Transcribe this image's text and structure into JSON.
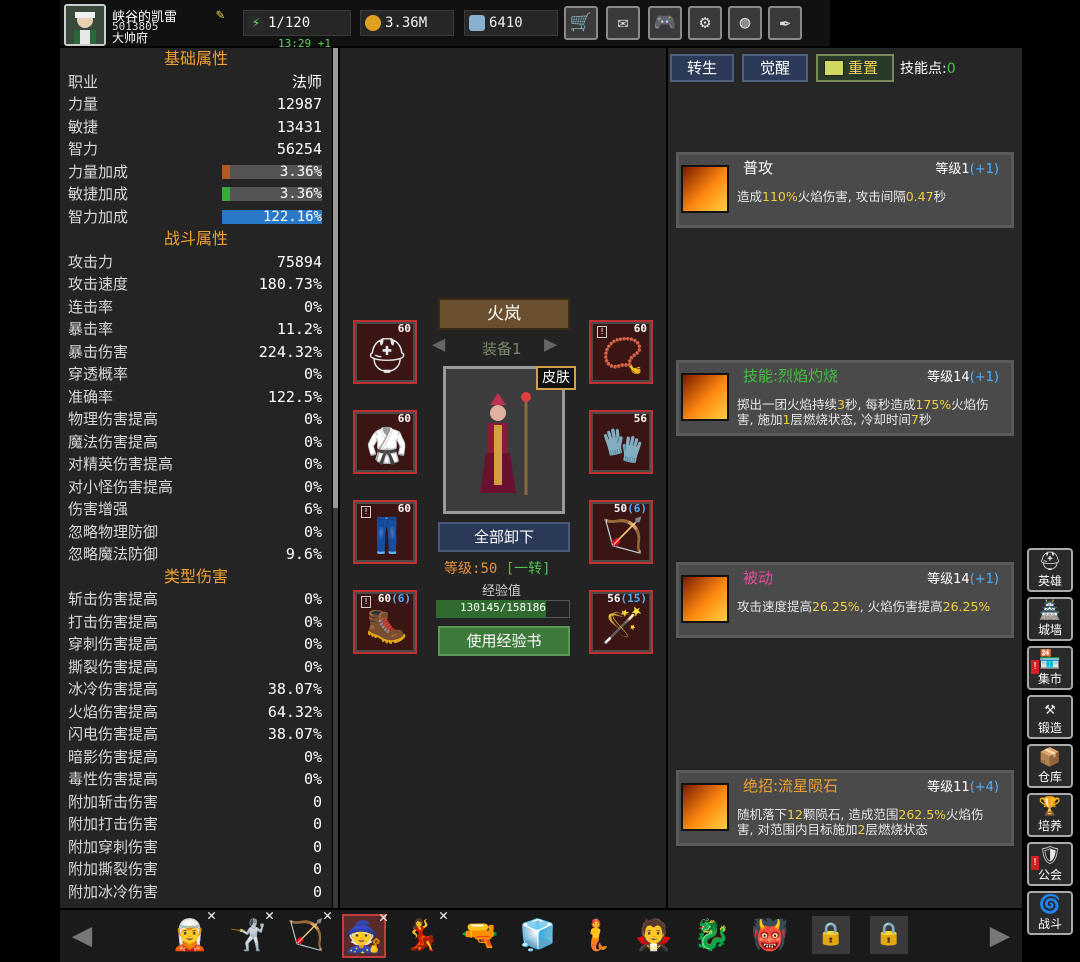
{
  "player": {
    "name": "峡谷的凯雷",
    "id": "5013805",
    "title": "大帅府",
    "timer": "13:29 +1"
  },
  "resources": {
    "energy": "1/120",
    "gold": "3.36M",
    "gems": "6410"
  },
  "toolbar": [
    {
      "icon": "shop-cart-icon",
      "glyph": "🛒"
    },
    {
      "icon": "mail-icon",
      "glyph": "✉"
    },
    {
      "icon": "gamepad-icon",
      "glyph": "🎮"
    },
    {
      "icon": "gear-icon",
      "glyph": "⚙"
    },
    {
      "icon": "color-wheel-icon",
      "glyph": "◍"
    },
    {
      "icon": "quill-icon",
      "glyph": "✒"
    }
  ],
  "stats": {
    "basic_header": "基础属性",
    "basic": [
      {
        "k": "职业",
        "v": "法师"
      },
      {
        "k": "力量",
        "v": "12987"
      },
      {
        "k": "敏捷",
        "v": "13431"
      },
      {
        "k": "智力",
        "v": "56254"
      }
    ],
    "bonus": [
      {
        "k": "力量加成",
        "v": "3.36%",
        "fill": 0.08,
        "color": "#b05a28"
      },
      {
        "k": "敏捷加成",
        "v": "3.36%",
        "fill": 0.08,
        "color": "#38a838"
      },
      {
        "k": "智力加成",
        "v": "122.16%",
        "fill": 1.0,
        "color": "#2a78c8"
      }
    ],
    "combat_header": "战斗属性",
    "combat": [
      {
        "k": "攻击力",
        "v": "75894"
      },
      {
        "k": "攻击速度",
        "v": "180.73%"
      },
      {
        "k": "连击率",
        "v": "0%"
      },
      {
        "k": "暴击率",
        "v": "11.2%"
      },
      {
        "k": "暴击伤害",
        "v": "224.32%"
      },
      {
        "k": "穿透概率",
        "v": "0%"
      },
      {
        "k": "准确率",
        "v": "122.5%"
      },
      {
        "k": "物理伤害提高",
        "v": "0%"
      },
      {
        "k": "魔法伤害提高",
        "v": "0%"
      },
      {
        "k": "对精英伤害提高",
        "v": "0%"
      },
      {
        "k": "对小怪伤害提高",
        "v": "0%"
      },
      {
        "k": "伤害增强",
        "v": "6%"
      },
      {
        "k": "忽略物理防御",
        "v": "0%"
      },
      {
        "k": "忽略魔法防御",
        "v": "9.6%"
      }
    ],
    "type_header": "类型伤害",
    "type": [
      {
        "k": "斩击伤害提高",
        "v": "0%"
      },
      {
        "k": "打击伤害提高",
        "v": "0%"
      },
      {
        "k": "穿刺伤害提高",
        "v": "0%"
      },
      {
        "k": "撕裂伤害提高",
        "v": "0%"
      },
      {
        "k": "冰冷伤害提高",
        "v": "38.07%"
      },
      {
        "k": "火焰伤害提高",
        "v": "64.32%"
      },
      {
        "k": "闪电伤害提高",
        "v": "38.07%"
      },
      {
        "k": "暗影伤害提高",
        "v": "0%"
      },
      {
        "k": "毒性伤害提高",
        "v": "0%"
      },
      {
        "k": "附加斩击伤害",
        "v": "0"
      },
      {
        "k": "附加打击伤害",
        "v": "0"
      },
      {
        "k": "附加穿刺伤害",
        "v": "0"
      },
      {
        "k": "附加撕裂伤害",
        "v": "0"
      },
      {
        "k": "附加冰冷伤害",
        "v": "0"
      }
    ]
  },
  "equipment": {
    "hero_name": "火岚",
    "set_name": "装备1",
    "skin_label": "皮肤",
    "unequip_label": "全部卸下",
    "level_label": "等级:",
    "level": "50",
    "rebirth": "[一转]",
    "exp_label": "经验值",
    "exp": "130145/158186",
    "exp_fraction": 0.823,
    "use_book_label": "使用经验书",
    "slots": [
      {
        "name": "helmet-slot",
        "level": "60",
        "extra": "",
        "glyph": "⛑",
        "flag": false
      },
      {
        "name": "necklace-slot",
        "level": "60",
        "extra": "",
        "glyph": "📿",
        "flag": true
      },
      {
        "name": "armor-slot",
        "level": "60",
        "extra": "",
        "glyph": "🥋",
        "flag": false
      },
      {
        "name": "gloves-slot",
        "level": "56",
        "extra": "",
        "glyph": "🧤",
        "flag": false
      },
      {
        "name": "pants-slot",
        "level": "60",
        "extra": "",
        "glyph": "👖",
        "flag": true
      },
      {
        "name": "offhand-slot",
        "level": "50",
        "extra": "(6)",
        "glyph": "🏹",
        "flag": false
      },
      {
        "name": "boots-slot",
        "level": "60",
        "extra": "(6)",
        "glyph": "🥾",
        "flag": true
      },
      {
        "name": "staff-slot",
        "level": "56",
        "extra": "(15)",
        "glyph": "🪄",
        "flag": false
      }
    ]
  },
  "skills_panel": {
    "rebirth_tab": "转生",
    "awaken_tab": "觉醒",
    "reset_label": "重置",
    "points_label": "技能点:",
    "points": "0",
    "cards": [
      {
        "name": "普攻",
        "name_color": "#ffffff",
        "level": "等级1",
        "bonus": "(+1)",
        "desc_parts": [
          "造成",
          "110%",
          "火焰伤害, 攻击间隔",
          "0.47",
          "秒"
        ]
      },
      {
        "name": "技能:烈焰灼烧",
        "name_color": "#40c040",
        "level": "等级14",
        "bonus": "(+1)",
        "desc_parts": [
          "掷出一团火焰持续",
          "3",
          "秒, 每秒造成",
          "175%",
          "火焰伤害, 施加",
          "1",
          "层燃烧状态, 冷却时间",
          "7",
          "秒"
        ]
      },
      {
        "name": "被动",
        "name_color": "#e84a9a",
        "level": "等级14",
        "bonus": "(+1)",
        "desc_parts": [
          "攻击速度提高",
          "26.25%",
          ", 火焰伤害提高",
          "26.25%",
          ""
        ]
      },
      {
        "name": "绝招:流星陨石",
        "name_color": "#f0a030",
        "level": "等级11",
        "bonus": "(+4)",
        "desc_parts": [
          "随机落下",
          "12",
          "颗陨石, 造成范围",
          "262.5%",
          "火焰伤害, 对范围内目标施加",
          "2",
          "层燃烧状态"
        ]
      }
    ]
  },
  "side_nav": [
    {
      "label": "英雄",
      "icon": "helmet-icon",
      "glyph": "⛑",
      "alert": false
    },
    {
      "label": "城墙",
      "icon": "wall-icon",
      "glyph": "🏯",
      "alert": false
    },
    {
      "label": "集市",
      "icon": "market-icon",
      "glyph": "🏪",
      "alert": true
    },
    {
      "label": "锻造",
      "icon": "anvil-icon",
      "glyph": "⚒",
      "alert": false
    },
    {
      "label": "仓库",
      "icon": "chest-icon",
      "glyph": "📦",
      "alert": false
    },
    {
      "label": "培养",
      "icon": "trophy-icon",
      "glyph": "🏆",
      "alert": false
    },
    {
      "label": "公会",
      "icon": "guild-icon",
      "glyph": "🛡",
      "alert": true
    },
    {
      "label": "战斗",
      "icon": "portal-icon",
      "glyph": "🌀",
      "alert": false
    }
  ],
  "heroes": [
    {
      "icon": "elf-hero-icon",
      "glyph": "🧝",
      "x": true,
      "selected": false
    },
    {
      "icon": "knight-hero-icon",
      "glyph": "🤺",
      "x": true,
      "selected": false
    },
    {
      "icon": "archer-hero-icon",
      "glyph": "🏹",
      "x": true,
      "selected": false
    },
    {
      "icon": "mage-hero-icon",
      "glyph": "🧙",
      "x": true,
      "selected": true
    },
    {
      "icon": "dancer-hero-icon",
      "glyph": "💃",
      "x": true,
      "selected": false
    },
    {
      "icon": "gunner-hero-icon",
      "glyph": "🔫",
      "x": false,
      "selected": false
    },
    {
      "icon": "ice-hero-icon",
      "glyph": "🧊",
      "x": false,
      "selected": false
    },
    {
      "icon": "water-hero-icon",
      "glyph": "🧜",
      "x": false,
      "selected": false
    },
    {
      "icon": "warlock-hero-icon",
      "glyph": "🧛",
      "x": false,
      "selected": false
    },
    {
      "icon": "beast-hero-icon",
      "glyph": "🐉",
      "x": false,
      "selected": false
    },
    {
      "icon": "demon-hero-icon",
      "glyph": "👹",
      "x": false,
      "selected": false
    }
  ]
}
